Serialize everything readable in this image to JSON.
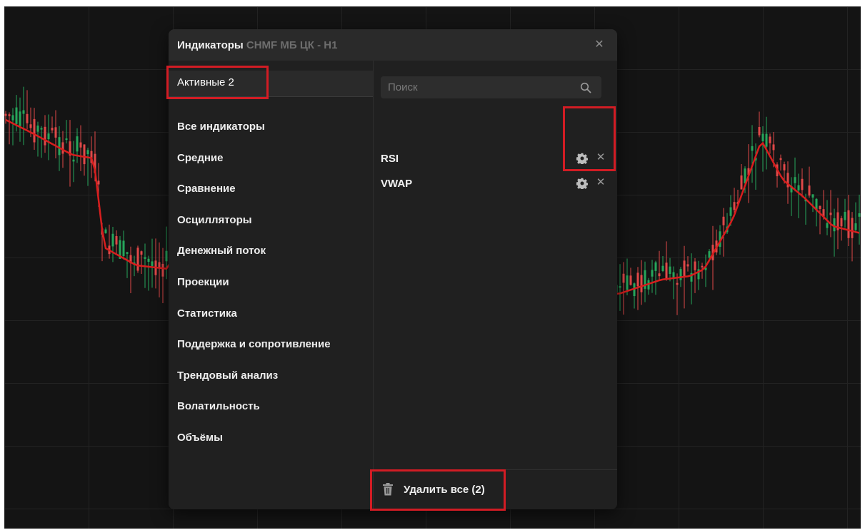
{
  "dialog": {
    "title": "Индикаторы",
    "subtitle": "CHMF МБ ЦК - H1",
    "close_icon": "close-icon"
  },
  "tabs": {
    "active_label": "Активные 2"
  },
  "categories": [
    "Все индикаторы",
    "Средние",
    "Сравнение",
    "Осцилляторы",
    "Денежный поток",
    "Проекции",
    "Статистика",
    "Поддержка и сопротивление",
    "Трендовый анализ",
    "Волатильность",
    "Объёмы"
  ],
  "search": {
    "placeholder": "Поиск",
    "value": ""
  },
  "active_indicators": [
    {
      "name": "RSI",
      "settings_icon": "gear-icon",
      "remove_icon": "close-icon"
    },
    {
      "name": "VWAP",
      "settings_icon": "gear-icon",
      "remove_icon": "close-icon"
    }
  ],
  "footer": {
    "delete_all_label": "Удалить все (2)",
    "delete_icon": "trash-icon"
  },
  "colors": {
    "background": "#141414",
    "dialog": "#202020",
    "candle_up": "#26a65b",
    "candle_down": "#e04848",
    "vwap_line": "#d81e1e",
    "highlight": "#d21c24"
  }
}
